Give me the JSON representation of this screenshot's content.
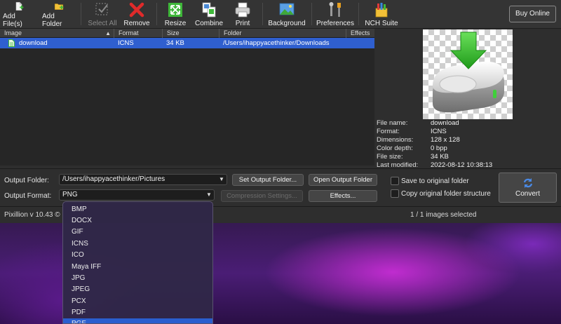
{
  "toolbar": {
    "add_files": "Add File(s)",
    "add_folder": "Add Folder",
    "select_all": "Select All",
    "remove": "Remove",
    "resize": "Resize",
    "combine": "Combine",
    "print": "Print",
    "background": "Background",
    "preferences": "Preferences",
    "nch_suite": "NCH Suite",
    "buy_online": "Buy Online"
  },
  "file_list": {
    "columns": [
      "Image",
      "Format",
      "Size",
      "Folder",
      "Effects"
    ],
    "rows": [
      {
        "image": "download",
        "format": "ICNS",
        "size": "34 KB",
        "folder": "/Users/ihappyacethinker/Downloads",
        "effects": ""
      }
    ]
  },
  "info": {
    "labels": [
      "File name:",
      "Format:",
      "Dimensions:",
      "Color depth:",
      "File size:",
      "Last modified:"
    ],
    "values": [
      "download",
      "ICNS",
      "128 x 128",
      "0 bpp",
      "34 KB",
      "2022-08-12 10:38:13"
    ]
  },
  "output": {
    "folder_label": "Output Folder:",
    "folder_value": "/Users/ihappyacethinker/Pictures",
    "format_label": "Output Format:",
    "format_value": "PNG",
    "set_folder": "Set Output Folder...",
    "open_folder": "Open Output Folder",
    "compression": "Compression Settings...",
    "effects": "Effects...",
    "save_original": "Save to original folder",
    "copy_structure": "Copy original folder structure",
    "convert": "Convert"
  },
  "status": {
    "version": "Pixillion v 10.43 ©",
    "selected": "1 / 1 images selected"
  },
  "format_options": [
    "BMP",
    "DOCX",
    "GIF",
    "ICNS",
    "ICO",
    "Maya IFF",
    "JPG",
    "JPEG",
    "PCX",
    "PDF",
    "PGF"
  ],
  "colors": {
    "selection": "#2f5fcf",
    "accent_green": "#3fb83a",
    "remove_red": "#e02a2a"
  }
}
